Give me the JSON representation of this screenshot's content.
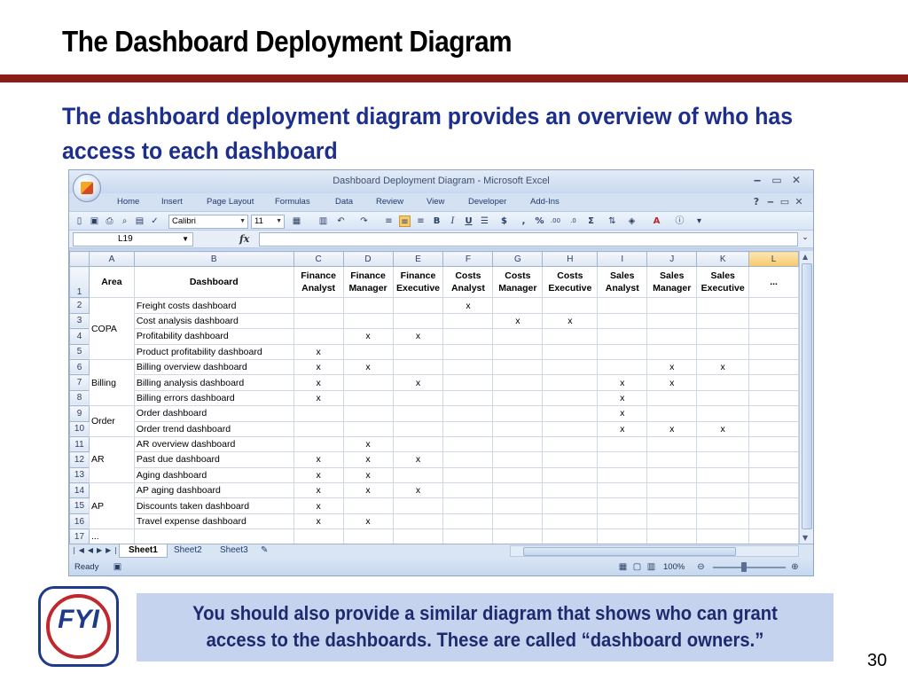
{
  "slide": {
    "title": "The Dashboard Deployment Diagram",
    "subtitle": "The dashboard deployment diagram provides an overview of who has access to each dashboard",
    "note": "You should also provide a similar diagram that shows who can grant access to the dashboards. These are called “dashboard owners.”",
    "fyi_label": "FYI",
    "page_number": "30",
    "accent_color": "#8c1d18",
    "subtitle_color": "#1d2f8c"
  },
  "excel": {
    "window_title": "Dashboard Deployment Diagram - Microsoft Excel",
    "ribbon_tabs": [
      "Home",
      "Insert",
      "Page Layout",
      "Formulas",
      "Data",
      "Review",
      "View",
      "Developer",
      "Add-Ins"
    ],
    "font_name": "Calibri",
    "font_size": "11",
    "name_box": "L19",
    "fx_label": "fx",
    "columns": [
      "",
      "A",
      "B",
      "C",
      "D",
      "E",
      "F",
      "G",
      "H",
      "I",
      "J",
      "K",
      "L"
    ],
    "header_row": {
      "row": "1",
      "area": "Area",
      "dashboard": "Dashboard",
      "roles": [
        "Finance Analyst",
        "Finance Manager",
        "Finance Executive",
        "Costs Analyst",
        "Costs Manager",
        "Costs Executive",
        "Sales Analyst",
        "Sales Manager",
        "Sales Executive",
        "..."
      ]
    },
    "rows": [
      {
        "row": "2",
        "area": "",
        "dashboard": "Freight costs dashboard",
        "marks": [
          "",
          "",
          "",
          "x",
          "",
          "",
          "",
          "",
          "",
          ""
        ]
      },
      {
        "row": "3",
        "area": "COPA",
        "dashboard": "Cost analysis dashboard",
        "marks": [
          "",
          "",
          "",
          "",
          "x",
          "x",
          "",
          "",
          "",
          ""
        ]
      },
      {
        "row": "4",
        "area": "",
        "dashboard": "Profitability dashboard",
        "marks": [
          "",
          "x",
          "x",
          "",
          "",
          "",
          "",
          "",
          "",
          ""
        ]
      },
      {
        "row": "5",
        "area": "",
        "dashboard": "Product profitability  dashboard",
        "marks": [
          "x",
          "",
          "",
          "",
          "",
          "",
          "",
          "",
          "",
          ""
        ]
      },
      {
        "row": "6",
        "area": "",
        "dashboard": "Billing overview dashboard",
        "marks": [
          "x",
          "x",
          "",
          "",
          "",
          "",
          "",
          "x",
          "x",
          ""
        ]
      },
      {
        "row": "7",
        "area": "Billing",
        "dashboard": "Billing analysis dashboard",
        "marks": [
          "x",
          "",
          "x",
          "",
          "",
          "",
          "x",
          "x",
          "",
          ""
        ]
      },
      {
        "row": "8",
        "area": "",
        "dashboard": "Billing errors dashboard",
        "marks": [
          "x",
          "",
          "",
          "",
          "",
          "",
          "x",
          "",
          "",
          ""
        ]
      },
      {
        "row": "9",
        "area": "Order",
        "dashboard": "Order dashboard",
        "marks": [
          "",
          "",
          "",
          "",
          "",
          "",
          "x",
          "",
          "",
          ""
        ]
      },
      {
        "row": "10",
        "area": "",
        "dashboard": "Order trend  dashboard",
        "marks": [
          "",
          "",
          "",
          "",
          "",
          "",
          "x",
          "x",
          "x",
          ""
        ]
      },
      {
        "row": "11",
        "area": "",
        "dashboard": "AR overview dashboard",
        "marks": [
          "",
          "x",
          "",
          "",
          "",
          "",
          "",
          "",
          "",
          ""
        ]
      },
      {
        "row": "12",
        "area": "AR",
        "dashboard": "Past due dashboard",
        "marks": [
          "x",
          "x",
          "x",
          "",
          "",
          "",
          "",
          "",
          "",
          ""
        ]
      },
      {
        "row": "13",
        "area": "",
        "dashboard": "Aging  dashboard",
        "marks": [
          "x",
          "x",
          "",
          "",
          "",
          "",
          "",
          "",
          "",
          ""
        ]
      },
      {
        "row": "14",
        "area": "",
        "dashboard": "AP aging dashboard",
        "marks": [
          "x",
          "x",
          "x",
          "",
          "",
          "",
          "",
          "",
          "",
          ""
        ]
      },
      {
        "row": "15",
        "area": "AP",
        "dashboard": "Discounts taken dashboard",
        "marks": [
          "x",
          "",
          "",
          "",
          "",
          "",
          "",
          "",
          "",
          ""
        ]
      },
      {
        "row": "16",
        "area": "",
        "dashboard": "Travel expense dashboard",
        "marks": [
          "x",
          "x",
          "",
          "",
          "",
          "",
          "",
          "",
          "",
          ""
        ]
      },
      {
        "row": "17",
        "area": "...",
        "dashboard": "",
        "marks": [
          "",
          "",
          "",
          "",
          "",
          "",
          "",
          "",
          "",
          ""
        ]
      }
    ],
    "sheet_tabs": [
      "Sheet1",
      "Sheet2",
      "Sheet3"
    ],
    "status": "Ready",
    "zoom": "100%"
  }
}
